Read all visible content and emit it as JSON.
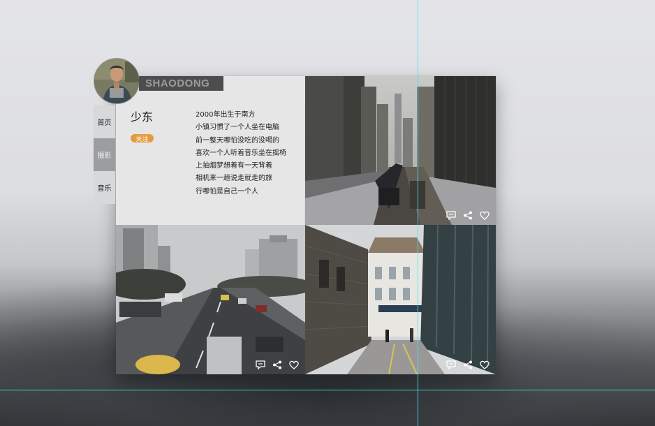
{
  "profile": {
    "brand_name": "SHAODONG",
    "display_name": "少东",
    "follow_label": "关注",
    "bio_lines": [
      "2000年出生于南方",
      "小镇习惯了一个人坐在电脑",
      "前一整天哪怕没吃的没喝的",
      "喜欢一个人听着音乐坐在摇椅",
      "上抽烟梦想着有一天背着",
      "相机来一趟说走就走的旅",
      "行哪怕是自己一个人"
    ]
  },
  "nav": {
    "items": [
      {
        "label": "首页"
      },
      {
        "label": "摄影"
      },
      {
        "label": "音乐"
      }
    ],
    "active_index": 1
  },
  "photos": [
    {
      "subject": "elevated-train-city",
      "actions": [
        "comment-icon",
        "share-icon",
        "heart-icon"
      ]
    },
    {
      "subject": "city-highway-traffic",
      "actions": [
        "comment-icon",
        "share-icon",
        "heart-icon"
      ]
    },
    {
      "subject": "brick-alley-street",
      "actions": [
        "comment-icon",
        "share-icon",
        "heart-icon"
      ]
    }
  ],
  "colors": {
    "follow_button": "#e49b3c",
    "banner_bg": "#4d4d4f",
    "active_nav": "#9c9d9f",
    "guide_line": "#4fe3f0"
  }
}
